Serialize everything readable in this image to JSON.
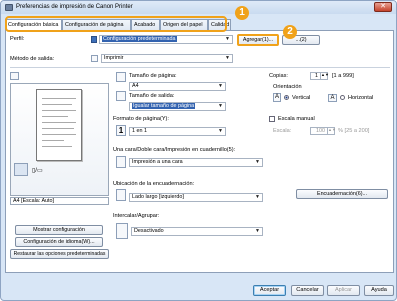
{
  "window": {
    "title": "Preferencias de impresión de Canon Printer",
    "close_glyph": "✕"
  },
  "tabs": [
    {
      "label": "Configuración básica"
    },
    {
      "label": "Configuración de página"
    },
    {
      "label": "Acabado"
    },
    {
      "label": "Origen del papel"
    },
    {
      "label": "Calidad"
    }
  ],
  "callouts": {
    "one": "1",
    "two": "2"
  },
  "profile": {
    "label": "Perfil:",
    "value": "Configuración predeterminada",
    "add_button": "Agregar(1)...",
    "edit_button": "...(2)"
  },
  "output_method": {
    "label": "Método de salida:",
    "value": "Imprimir"
  },
  "preview": {
    "caption": "A4 [Escala: Auto]",
    "view_toggle": "▯/▭"
  },
  "left_buttons": {
    "show_settings": "Mostrar configuración",
    "language_settings": "Configuración de idioma(W)...",
    "restore_defaults": "Restaurar las opciones predeterminadas"
  },
  "page_size": {
    "label": "Tamaño de página:",
    "value": "A4"
  },
  "output_size": {
    "label": "Tamaño de salida:",
    "value": "Igualar tamaño de página"
  },
  "copies": {
    "label": "Copias:",
    "value": "1",
    "range": "[1 a 999]"
  },
  "orientation": {
    "label": "Orientación",
    "portrait": "Vertical",
    "landscape": "Horizontal",
    "portrait_icon": "A",
    "landscape_icon": "A"
  },
  "page_format": {
    "label": "Formato de página(Y):",
    "value": "1 en 1",
    "icon_text": "1"
  },
  "manual_scale": {
    "label": "Escala manual",
    "scale_label": "Escala:",
    "scale_value": "100",
    "scale_range": "% [25 a 200]"
  },
  "duplex": {
    "label": "Una cara/Doble cara/Impresión en cuadernillo(5):",
    "value": "Impresión a una cara"
  },
  "binding": {
    "label": "Ubicación de la encuadernación:",
    "value": "Lado largo [izquierdo]",
    "button": "Encuadernación(6)..."
  },
  "collate": {
    "label": "Intercalar/Agrupar:",
    "value": "Desactivado"
  },
  "bottom": {
    "accept": "Aceptar",
    "cancel": "Cancelar",
    "apply": "Aplicar",
    "help": "Ayuda"
  },
  "colors": {
    "accent": "#f0a21a",
    "selection": "#3363b0"
  }
}
